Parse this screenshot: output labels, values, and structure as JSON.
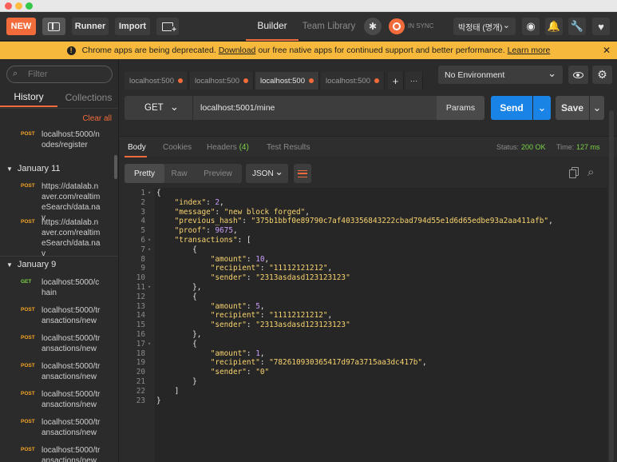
{
  "toolbar": {
    "new_label": "NEW",
    "runner_label": "Runner",
    "import_label": "Import",
    "builder_tab": "Builder",
    "team_tab": "Team Library",
    "sync_label": "IN SYNC",
    "user_label": "박정태 (명개)"
  },
  "banner": {
    "text": "Chrome apps are being deprecated.",
    "download_link": "Download",
    "middle_text": "our free native apps for continued support and better performance.",
    "learn_link": "Learn more"
  },
  "sidebar": {
    "filter_placeholder": "Filter",
    "tab_history": "History",
    "tab_collections": "Collections",
    "clear_all": "Clear all",
    "top_request": {
      "method": "POST",
      "url": "localhost:5000/nodes/register"
    },
    "groups": [
      {
        "label": "January 11",
        "requests": [
          {
            "method": "POST",
            "url": "https://datalab.naver.com/realtimeSearch/data.nav"
          },
          {
            "method": "POST",
            "url": "https://datalab.naver.com/realtimeSearch/data.nav"
          }
        ]
      },
      {
        "label": "January 9",
        "requests": [
          {
            "method": "GET",
            "url": "localhost:5000/chain"
          },
          {
            "method": "POST",
            "url": "localhost:5000/transactions/new"
          },
          {
            "method": "POST",
            "url": "localhost:5000/transactions/new"
          },
          {
            "method": "POST",
            "url": "localhost:5000/transactions/new"
          },
          {
            "method": "POST",
            "url": "localhost:5000/transactions/new"
          },
          {
            "method": "POST",
            "url": "localhost:5000/transactions/new"
          },
          {
            "method": "POST",
            "url": "localhost:5000/transactions/new"
          }
        ]
      }
    ]
  },
  "tabs": [
    "localhost:500",
    "localhost:500",
    "localhost:500",
    "localhost:500"
  ],
  "environment": "No Environment",
  "request": {
    "method": "GET",
    "url": "localhost:5001/mine",
    "params_label": "Params",
    "send_label": "Send",
    "save_label": "Save"
  },
  "response_tabs": {
    "body": "Body",
    "cookies": "Cookies",
    "headers": "Headers",
    "headers_count": "(4)",
    "tests": "Test Results"
  },
  "status": {
    "status_label": "Status:",
    "status_value": "200 OK",
    "time_label": "Time:",
    "time_value": "127 ms"
  },
  "view_modes": {
    "pretty": "Pretty",
    "raw": "Raw",
    "preview": "Preview",
    "format": "JSON"
  },
  "response_lines": [
    "{",
    "    \"index\": 2,",
    "    \"message\": \"new block forged\",",
    "    \"previous_hash\": \"375b1bbf0e89790c7af403356843222cbad794d55e1d6d65edbe93a2aa411afb\",",
    "    \"proof\": 9675,",
    "    \"transactions\": [",
    "        {",
    "            \"amount\": 10,",
    "            \"recipient\": \"11112121212\",",
    "            \"sender\": \"2313asdasd123123123\"",
    "        },",
    "        {",
    "            \"amount\": 5,",
    "            \"recipient\": \"11112121212\",",
    "            \"sender\": \"2313asdasd123123123\"",
    "        },",
    "        {",
    "            \"amount\": 1,",
    "            \"recipient\": \"782610930365417d97a3715aa3dc417b\",",
    "            \"sender\": \"0\"",
    "        }",
    "    ]",
    "}"
  ],
  "colors": {
    "accent_orange": "#f26b3a",
    "send_blue": "#1a84e6",
    "status_green": "#7bd148",
    "banner_yellow": "#f6b93b"
  }
}
